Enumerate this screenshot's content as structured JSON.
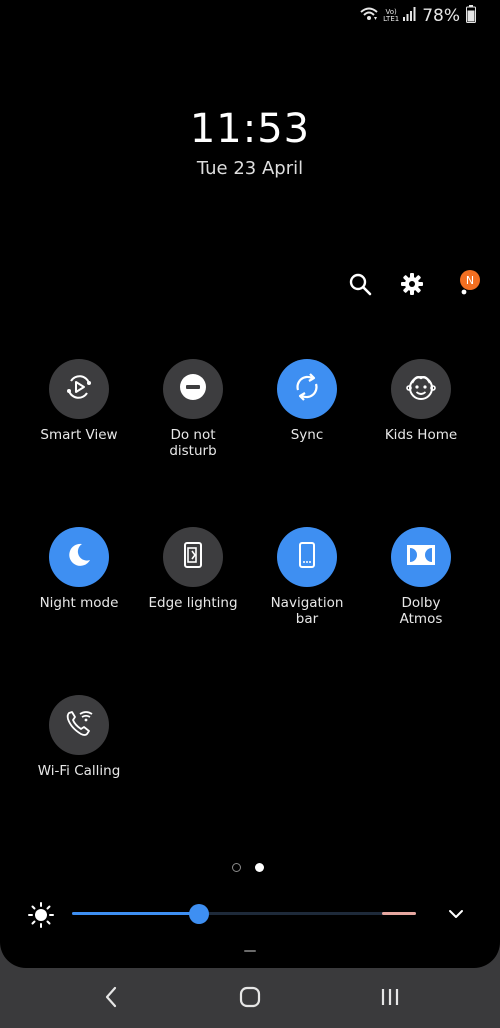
{
  "status_bar": {
    "volte_top": "Vo)",
    "volte_bottom": "LTE1",
    "battery_percent": "78%",
    "icons": [
      "wifi-calling-icon",
      "signal-icon",
      "battery-icon"
    ]
  },
  "clock": {
    "time": "11:53",
    "date": "Tue 23 April"
  },
  "top_actions": {
    "icons": [
      "search-icon",
      "gear-icon",
      "more-vertical-icon"
    ],
    "badge": "N"
  },
  "tiles": [
    {
      "label": "Smart View",
      "icon": "smart-view-icon",
      "active": false
    },
    {
      "label": "Do not\ndisturb",
      "icon": "do-not-disturb-icon",
      "active": false
    },
    {
      "label": "Sync",
      "icon": "sync-icon",
      "active": true
    },
    {
      "label": "Kids Home",
      "icon": "kids-home-icon",
      "active": false
    },
    {
      "label": "Night mode",
      "icon": "moon-icon",
      "active": true
    },
    {
      "label": "Edge lighting",
      "icon": "edge-lighting-icon",
      "active": false
    },
    {
      "label": "Navigation\nbar",
      "icon": "navigation-bar-icon",
      "active": true
    },
    {
      "label": "Dolby\nAtmos",
      "icon": "dolby-icon",
      "active": true
    },
    {
      "label": "Wi-Fi Calling",
      "icon": "wifi-call-icon",
      "active": false
    }
  ],
  "pager": {
    "pages": 2,
    "current": 2
  },
  "brightness": {
    "level_percent": 37,
    "icon": "sun-icon"
  },
  "colors": {
    "accent": "#3e8ff2",
    "tile_off": "#3d3d3f",
    "badge": "#f36f21",
    "background": "#000000"
  },
  "nav_bar": {
    "icons": [
      "back-icon",
      "home-icon",
      "recents-icon"
    ]
  }
}
